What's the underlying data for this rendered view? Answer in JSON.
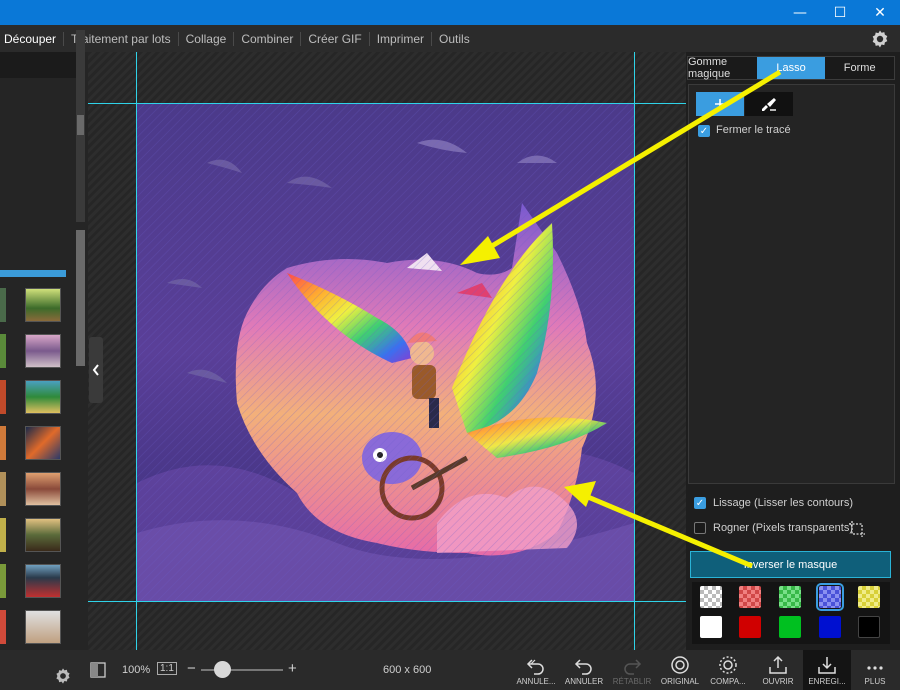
{
  "window": {
    "minimize": "—",
    "maximize": "☐",
    "close": "✕"
  },
  "menu": {
    "items": [
      "Découper",
      "Traitement par lots",
      "Collage",
      "Combiner",
      "Créer GIF",
      "Imprimer",
      "Outils"
    ],
    "settings_icon": "gear-icon"
  },
  "tabs": {
    "items": [
      "Gomme magique",
      "Lasso",
      "Forme"
    ],
    "active": "Lasso"
  },
  "tools": {
    "add_icon": "plus-icon",
    "erase_icon": "brush-erase-icon"
  },
  "options": {
    "close_path": {
      "label": "Fermer le tracé",
      "checked": true
    },
    "smoothing": {
      "label": "Lissage (Lisser les contours)",
      "checked": true
    },
    "crop": {
      "label": "Rogner (Pixels transparents)",
      "checked": false
    }
  },
  "invert_button": "Inverser le masque",
  "swatch_colors": {
    "row1": [
      "transparent",
      "#e25454",
      "#48c95a",
      "#5a62e8",
      "#e8e04a"
    ],
    "row2": [
      "#ffffff",
      "#d00000",
      "#00c020",
      "#0010d0",
      "#000000"
    ],
    "selected_index": 3
  },
  "bottom": {
    "zoom": "100%",
    "ratio": "1:1",
    "zoom_level": 0.25,
    "dimensions": "600 x 600",
    "buttons": [
      "ANNULE...",
      "ANNULER",
      "RÉTABLIR",
      "ORIGINAL",
      "COMPA...",
      "OUVRIR",
      "ENREGI...",
      "PLUS"
    ]
  },
  "colors": {
    "accent": "#3a9de0",
    "guide": "#2fd3e8",
    "annotation_arrow": "#f5f000",
    "titlebar": "#0a78d7"
  }
}
